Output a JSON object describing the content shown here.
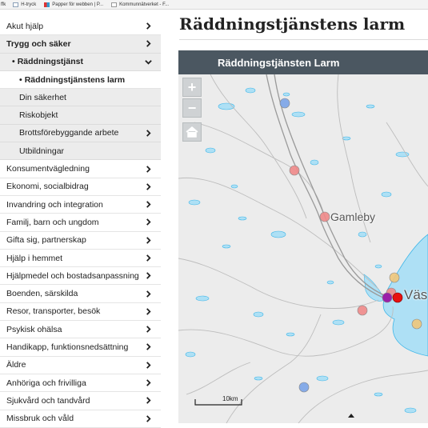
{
  "bookmarks": [
    {
      "label": "ffk",
      "icon": "none"
    },
    {
      "label": "H-tryck",
      "icon": "document-icon"
    },
    {
      "label": "Papper för webben | P...",
      "icon": "grid-icon"
    },
    {
      "label": "Kommunnätverket - F...",
      "icon": "page-icon"
    }
  ],
  "sidebar": {
    "items": [
      {
        "label": "Akut hjälp",
        "chevron": "right"
      },
      {
        "label": "Trygg och säker",
        "chevron": "right"
      },
      {
        "label": "Räddningstjänst",
        "chevron": "down"
      },
      {
        "label": "Räddningstjänstens larm",
        "chevron": "none"
      },
      {
        "label": "Din säkerhet",
        "chevron": "none"
      },
      {
        "label": "Riskobjekt",
        "chevron": "none"
      },
      {
        "label": "Brottsförebyggande arbete",
        "chevron": "right"
      },
      {
        "label": "Utbildningar",
        "chevron": "none"
      },
      {
        "label": "Konsumentvägledning",
        "chevron": "right"
      },
      {
        "label": "Ekonomi, socialbidrag",
        "chevron": "right"
      },
      {
        "label": "Invandring och integration",
        "chevron": "right"
      },
      {
        "label": "Familj, barn och ungdom",
        "chevron": "right"
      },
      {
        "label": "Gifta sig, partnerskap",
        "chevron": "right"
      },
      {
        "label": "Hjälp i hemmet",
        "chevron": "right"
      },
      {
        "label": "Hjälpmedel och bostadsanpassning",
        "chevron": "right"
      },
      {
        "label": "Boenden, särskilda",
        "chevron": "right"
      },
      {
        "label": "Resor, transporter, besök",
        "chevron": "right"
      },
      {
        "label": "Psykisk ohälsa",
        "chevron": "right"
      },
      {
        "label": "Handikapp, funktionsnedsättning",
        "chevron": "right"
      },
      {
        "label": "Äldre",
        "chevron": "right"
      },
      {
        "label": "Anhöriga och frivilliga",
        "chevron": "right"
      },
      {
        "label": "Sjukvård och tandvård",
        "chevron": "right"
      },
      {
        "label": "Missbruk och våld",
        "chevron": "right"
      }
    ]
  },
  "main": {
    "page_title": "Räddningstjänstens larm",
    "map_title": "Räddningstjänsten Larm"
  },
  "map": {
    "zoom_in": "+",
    "zoom_out": "−",
    "labels": {
      "town1": "Gamleby",
      "town2": "Väs"
    },
    "scale_label": "10km",
    "colors": {
      "water": "#aee0f5",
      "water_edge": "#3fb6e8",
      "land": "#ececec",
      "road": "#bfbfbf",
      "main_road": "#9a9a9a"
    },
    "markers": [
      {
        "color": "#7ba4e8",
        "kind": "blue"
      },
      {
        "color": "#f08a8a",
        "kind": "pink"
      },
      {
        "color": "#f08a8a",
        "kind": "pink"
      },
      {
        "color": "#f0c67a",
        "kind": "yellow"
      },
      {
        "color": "#f08a8a",
        "kind": "pink"
      },
      {
        "color": "#9b1fa8",
        "kind": "purple"
      },
      {
        "color": "#e81010",
        "kind": "red"
      },
      {
        "color": "#f08a8a",
        "kind": "pink"
      },
      {
        "color": "#f0c67a",
        "kind": "yellow"
      },
      {
        "color": "#7ba4e8",
        "kind": "blue"
      }
    ]
  }
}
